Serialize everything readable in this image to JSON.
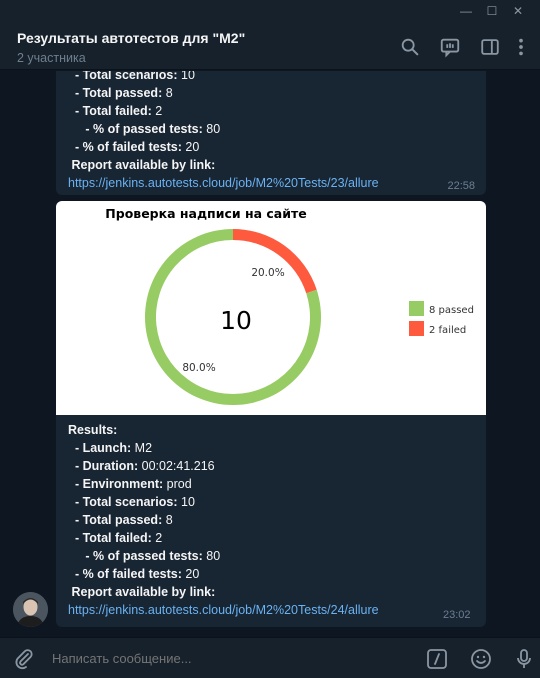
{
  "window": {
    "minimize_glyph": "—",
    "maximize_glyph": "☐",
    "close_glyph": "✕"
  },
  "header": {
    "title": "Результаты автотестов для \"M2\"",
    "subtitle": "2 участника"
  },
  "message1": {
    "lines": [
      {
        "label": "- Total scenarios:",
        "value": " 10",
        "indent": "  "
      },
      {
        "label": "- Total passed:",
        "value": " 8",
        "indent": "  "
      },
      {
        "label": "- Total failed:",
        "value": " 2",
        "indent": "  "
      },
      {
        "label": "- % of passed tests:",
        "value": " 80",
        "indent": "     "
      },
      {
        "label": "- % of failed tests:",
        "value": " 20",
        "indent": "  "
      }
    ],
    "report_label": "Report available by link:",
    "link": "https://jenkins.autotests.cloud/job/M2%20Tests/23/allure",
    "time": "22:58"
  },
  "message2": {
    "chart_title": "Проверка надписи на сайте",
    "results_label": "Results:",
    "lines": [
      {
        "label": "- Launch:",
        "value": " M2",
        "indent": "  "
      },
      {
        "label": "- Duration:",
        "value": " 00:02:41.216",
        "indent": "  "
      },
      {
        "label": "- Environment:",
        "value": " prod",
        "indent": "  "
      },
      {
        "label": "- Total scenarios:",
        "value": " 10",
        "indent": "  "
      },
      {
        "label": "- Total passed:",
        "value": " 8",
        "indent": "  "
      },
      {
        "label": "- Total failed:",
        "value": " 2",
        "indent": "  "
      },
      {
        "label": "- % of passed tests:",
        "value": " 80",
        "indent": "     "
      },
      {
        "label": "- % of failed tests:",
        "value": " 20",
        "indent": "  "
      }
    ],
    "report_label": "Report available by link:",
    "link": "https://jenkins.autotests.cloud/job/M2%20Tests/24/allure",
    "time": "23:02"
  },
  "composer": {
    "placeholder": "Написать сообщение..."
  },
  "colors": {
    "passed": "#97cc64",
    "failed": "#fd5a3e",
    "bubble": "#182533",
    "link": "#6ab2f2"
  },
  "chart_data": {
    "type": "pie",
    "title": "Проверка надписи на сайте",
    "center_label": "10",
    "slices": [
      {
        "name": "passed",
        "value": 8,
        "percent_label": "80.0%",
        "legend": "8 passed",
        "color": "#97cc64"
      },
      {
        "name": "failed",
        "value": 2,
        "percent_label": "20.0%",
        "legend": "2 failed",
        "color": "#fd5a3e"
      }
    ],
    "legend_position": "right"
  }
}
